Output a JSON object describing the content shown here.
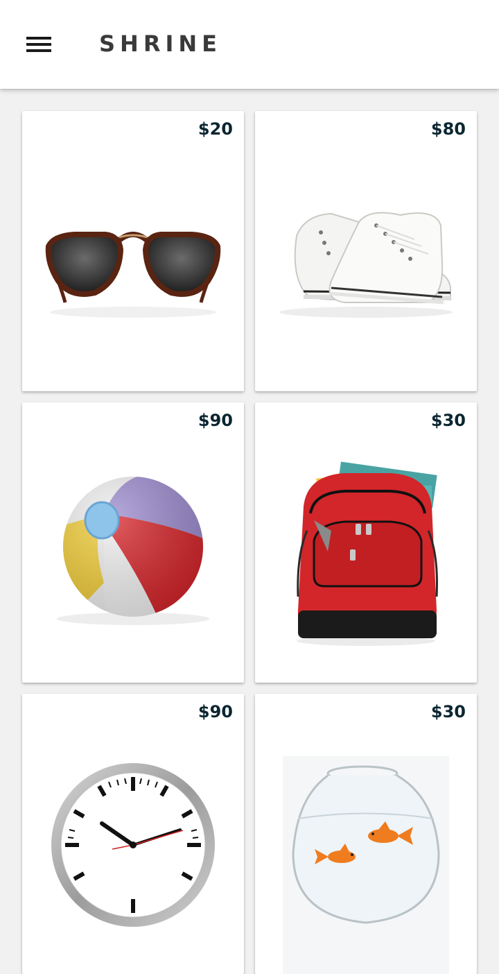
{
  "app": {
    "title": "SHRINE"
  },
  "products": [
    {
      "name": "sunglasses",
      "price": "$20"
    },
    {
      "name": "sneakers",
      "price": "$80"
    },
    {
      "name": "beach-ball",
      "price": "$90"
    },
    {
      "name": "backpack",
      "price": "$30"
    },
    {
      "name": "wall-clock",
      "price": "$90"
    },
    {
      "name": "fishbowl",
      "price": "$30"
    }
  ],
  "colors": {
    "price_text": "#0b2631",
    "background": "#f1f1f1",
    "card": "#ffffff"
  }
}
